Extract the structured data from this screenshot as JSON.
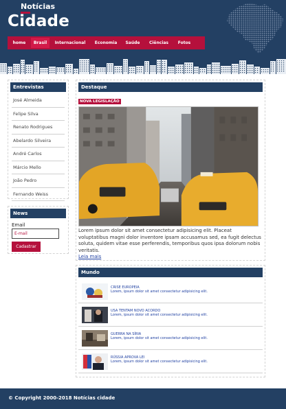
{
  "header": {
    "logo_top": "Notícias",
    "logo_main": "Cidade",
    "nav": [
      {
        "label": "home",
        "active": false
      },
      {
        "label": "Brasil",
        "active": true
      },
      {
        "label": "Internacional",
        "active": false
      },
      {
        "label": "Economia",
        "active": false
      },
      {
        "label": "Saúde",
        "active": false
      },
      {
        "label": "Ciências",
        "active": false
      },
      {
        "label": "Fotos",
        "active": false
      }
    ]
  },
  "sidebar": {
    "interviews_title": "Entrevistas",
    "interviews": [
      "José Almeida",
      "Felipe Silva",
      "Renato Rodrigues",
      "Abelardo Silveira",
      "André Carlos",
      "Márcio Mello",
      "João Pedro",
      "Fernando Weiss"
    ],
    "news_title": "News",
    "email_label": "Email",
    "email_placeholder": "E-mail",
    "subscribe_label": "Cadastrar"
  },
  "highlight": {
    "title": "Destaque",
    "badge": "NOVA LEGISLAÇÃO",
    "text": "Lorem ipsum dolor sit amet consectetur adipisicing elit. Placeat voluptatibus magni dolor inventore ipsam accusamus sed, ea fugit delectus soluta, quidem vitae esse perferendis, temporibus quos ipsa dolorum nobis veritatis.",
    "link": "Leia mais"
  },
  "world": {
    "title": "Mundo",
    "items": [
      {
        "title": "CRISE EUROPEIA",
        "text": "Lorem, ipsum dolor sit amet consectetur adipisicing elit."
      },
      {
        "title": "USA TENTAM NOVO ACORDO",
        "text": "Lorem, ipsum dolor sit amet consectetur adipisicing elit."
      },
      {
        "title": "GUERRA NA SÍRIA",
        "text": "Lorem, ipsum dolor sit amet consectetur adipisicing elit."
      },
      {
        "title": "RÚSSIA APROVA LEI",
        "text": "Lorem, ipsum dolor sit amet consectetur adipisicing elit."
      }
    ]
  },
  "footer": {
    "text": "© Copyright 2000-2018 Notícias cidade"
  },
  "colors": {
    "navy": "#234063",
    "brand_red": "#b5103c",
    "link_blue": "#1d3ea0"
  }
}
